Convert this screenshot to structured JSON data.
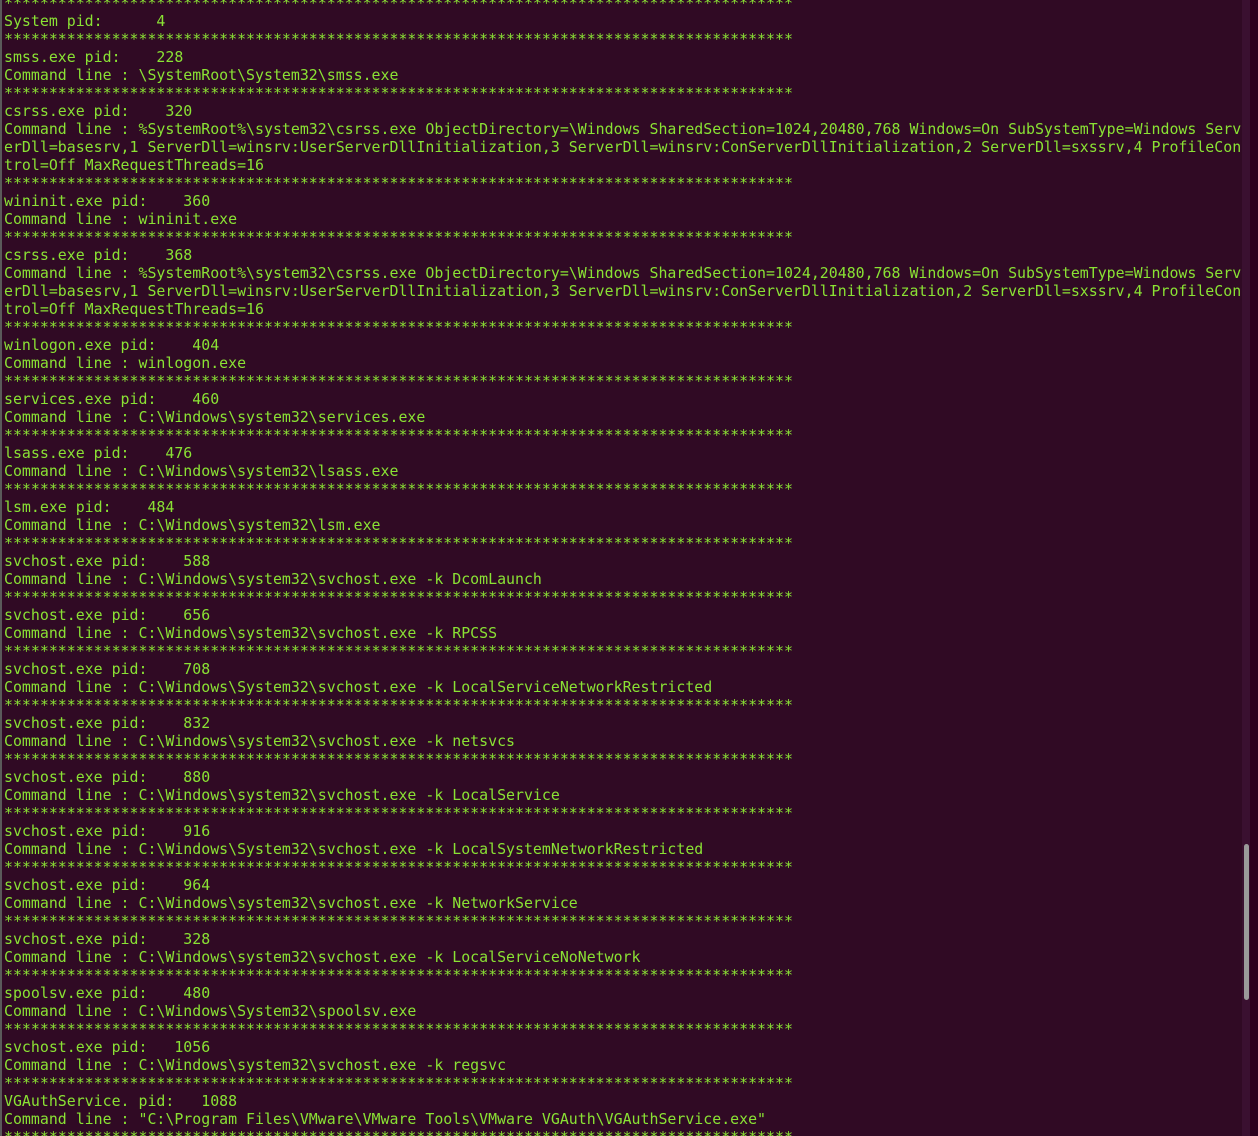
{
  "terminal": {
    "text_color": "#8ae234",
    "background": "#300a24",
    "lines": [
      {
        "type": "sep",
        "text": "****************************************************************************************"
      },
      {
        "type": "text",
        "text": "System pid:      4"
      },
      {
        "type": "sep",
        "text": "****************************************************************************************"
      },
      {
        "type": "text",
        "text": "smss.exe pid:    228"
      },
      {
        "type": "text",
        "text": "Command line : \\SystemRoot\\System32\\smss.exe"
      },
      {
        "type": "sep",
        "text": "****************************************************************************************"
      },
      {
        "type": "text",
        "text": "csrss.exe pid:    320"
      },
      {
        "type": "text",
        "text": "Command line : %SystemRoot%\\system32\\csrss.exe ObjectDirectory=\\Windows SharedSection=1024,20480,768 Windows=On SubSystemType=Windows Serv"
      },
      {
        "type": "text",
        "text": "erDll=basesrv,1 ServerDll=winsrv:UserServerDllInitialization,3 ServerDll=winsrv:ConServerDllInitialization,2 ServerDll=sxssrv,4 ProfileCon"
      },
      {
        "type": "text",
        "text": "trol=Off MaxRequestThreads=16"
      },
      {
        "type": "sep",
        "text": "****************************************************************************************"
      },
      {
        "type": "text",
        "text": "wininit.exe pid:    360"
      },
      {
        "type": "text",
        "text": "Command line : wininit.exe"
      },
      {
        "type": "sep",
        "text": "****************************************************************************************"
      },
      {
        "type": "text",
        "text": "csrss.exe pid:    368"
      },
      {
        "type": "text",
        "text": "Command line : %SystemRoot%\\system32\\csrss.exe ObjectDirectory=\\Windows SharedSection=1024,20480,768 Windows=On SubSystemType=Windows Serv"
      },
      {
        "type": "text",
        "text": "erDll=basesrv,1 ServerDll=winsrv:UserServerDllInitialization,3 ServerDll=winsrv:ConServerDllInitialization,2 ServerDll=sxssrv,4 ProfileCon"
      },
      {
        "type": "text",
        "text": "trol=Off MaxRequestThreads=16"
      },
      {
        "type": "sep",
        "text": "****************************************************************************************"
      },
      {
        "type": "text",
        "text": "winlogon.exe pid:    404"
      },
      {
        "type": "text",
        "text": "Command line : winlogon.exe"
      },
      {
        "type": "sep",
        "text": "****************************************************************************************"
      },
      {
        "type": "text",
        "text": "services.exe pid:    460"
      },
      {
        "type": "text",
        "text": "Command line : C:\\Windows\\system32\\services.exe"
      },
      {
        "type": "sep",
        "text": "****************************************************************************************"
      },
      {
        "type": "text",
        "text": "lsass.exe pid:    476"
      },
      {
        "type": "text",
        "text": "Command line : C:\\Windows\\system32\\lsass.exe"
      },
      {
        "type": "sep",
        "text": "****************************************************************************************"
      },
      {
        "type": "text",
        "text": "lsm.exe pid:    484"
      },
      {
        "type": "text",
        "text": "Command line : C:\\Windows\\system32\\lsm.exe"
      },
      {
        "type": "sep",
        "text": "****************************************************************************************"
      },
      {
        "type": "text",
        "text": "svchost.exe pid:    588"
      },
      {
        "type": "text",
        "text": "Command line : C:\\Windows\\system32\\svchost.exe -k DcomLaunch"
      },
      {
        "type": "sep",
        "text": "****************************************************************************************"
      },
      {
        "type": "text",
        "text": "svchost.exe pid:    656"
      },
      {
        "type": "text",
        "text": "Command line : C:\\Windows\\system32\\svchost.exe -k RPCSS"
      },
      {
        "type": "sep",
        "text": "****************************************************************************************"
      },
      {
        "type": "text",
        "text": "svchost.exe pid:    708"
      },
      {
        "type": "text",
        "text": "Command line : C:\\Windows\\System32\\svchost.exe -k LocalServiceNetworkRestricted"
      },
      {
        "type": "sep",
        "text": "****************************************************************************************"
      },
      {
        "type": "text",
        "text": "svchost.exe pid:    832"
      },
      {
        "type": "text",
        "text": "Command line : C:\\Windows\\system32\\svchost.exe -k netsvcs"
      },
      {
        "type": "sep",
        "text": "****************************************************************************************"
      },
      {
        "type": "text",
        "text": "svchost.exe pid:    880"
      },
      {
        "type": "text",
        "text": "Command line : C:\\Windows\\system32\\svchost.exe -k LocalService"
      },
      {
        "type": "sep",
        "text": "****************************************************************************************"
      },
      {
        "type": "text",
        "text": "svchost.exe pid:    916"
      },
      {
        "type": "text",
        "text": "Command line : C:\\Windows\\System32\\svchost.exe -k LocalSystemNetworkRestricted"
      },
      {
        "type": "sep",
        "text": "****************************************************************************************"
      },
      {
        "type": "text",
        "text": "svchost.exe pid:    964"
      },
      {
        "type": "text",
        "text": "Command line : C:\\Windows\\system32\\svchost.exe -k NetworkService"
      },
      {
        "type": "sep",
        "text": "****************************************************************************************"
      },
      {
        "type": "text",
        "text": "svchost.exe pid:    328"
      },
      {
        "type": "text",
        "text": "Command line : C:\\Windows\\system32\\svchost.exe -k LocalServiceNoNetwork"
      },
      {
        "type": "sep",
        "text": "****************************************************************************************"
      },
      {
        "type": "text",
        "text": "spoolsv.exe pid:    480"
      },
      {
        "type": "text",
        "text": "Command line : C:\\Windows\\System32\\spoolsv.exe"
      },
      {
        "type": "sep",
        "text": "****************************************************************************************"
      },
      {
        "type": "text",
        "text": "svchost.exe pid:   1056"
      },
      {
        "type": "text",
        "text": "Command line : C:\\Windows\\system32\\svchost.exe -k regsvc"
      },
      {
        "type": "sep",
        "text": "****************************************************************************************"
      },
      {
        "type": "text",
        "text": "VGAuthService. pid:   1088"
      },
      {
        "type": "text",
        "text": "Command line : \"C:\\Program Files\\VMware\\VMware Tools\\VMware VGAuth\\VGAuthService.exe\""
      },
      {
        "type": "sep",
        "text": "****************************************************************************************"
      }
    ]
  }
}
